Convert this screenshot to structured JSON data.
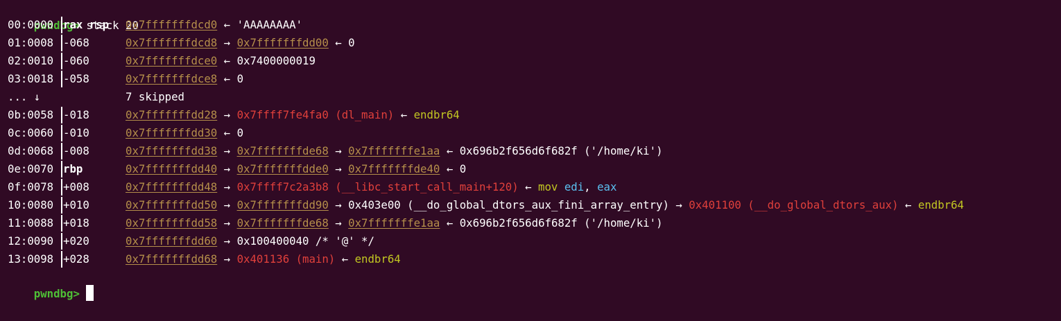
{
  "terminal": {
    "prompt": "pwndbg>",
    "command": "stack 20",
    "lines": [
      {
        "kind": "entry",
        "index": "00:0000",
        "off": "rax rsp",
        "off_bold": true,
        "chain": [
          {
            "t": "0x7fffffffdcd0",
            "c": "addr"
          },
          {
            "t": " ← ",
            "c": "white"
          },
          {
            "t": "'AAAAAAAA'",
            "c": "white"
          }
        ]
      },
      {
        "kind": "entry",
        "index": "01:0008",
        "off": "-068",
        "off_bold": false,
        "chain": [
          {
            "t": "0x7fffffffdcd8",
            "c": "addr"
          },
          {
            "t": " → ",
            "c": "white"
          },
          {
            "t": "0x7fffffffdd00",
            "c": "addr"
          },
          {
            "t": " ← ",
            "c": "white"
          },
          {
            "t": "0",
            "c": "white"
          }
        ]
      },
      {
        "kind": "entry",
        "index": "02:0010",
        "off": "-060",
        "off_bold": false,
        "chain": [
          {
            "t": "0x7fffffffdce0",
            "c": "addr"
          },
          {
            "t": " ← ",
            "c": "white"
          },
          {
            "t": "0x7400000019",
            "c": "white"
          }
        ]
      },
      {
        "kind": "entry",
        "index": "03:0018",
        "off": "-058",
        "off_bold": false,
        "chain": [
          {
            "t": "0x7fffffffdce8",
            "c": "addr"
          },
          {
            "t": " ← ",
            "c": "white"
          },
          {
            "t": "0",
            "c": "white"
          }
        ]
      },
      {
        "kind": "skip",
        "index": "... ↓",
        "text": "7 skipped"
      },
      {
        "kind": "entry",
        "index": "0b:0058",
        "off": "-018",
        "off_bold": false,
        "chain": [
          {
            "t": "0x7fffffffdd28",
            "c": "addr"
          },
          {
            "t": " → ",
            "c": "white"
          },
          {
            "t": "0x7ffff7fe4fa0 (dl_main)",
            "c": "code"
          },
          {
            "t": " ← ",
            "c": "white"
          },
          {
            "t": "endbr64",
            "c": "instr"
          }
        ]
      },
      {
        "kind": "entry",
        "index": "0c:0060",
        "off": "-010",
        "off_bold": false,
        "chain": [
          {
            "t": "0x7fffffffdd30",
            "c": "addr"
          },
          {
            "t": " ← ",
            "c": "white"
          },
          {
            "t": "0",
            "c": "white"
          }
        ]
      },
      {
        "kind": "entry",
        "index": "0d:0068",
        "off": "-008",
        "off_bold": false,
        "chain": [
          {
            "t": "0x7fffffffdd38",
            "c": "addr"
          },
          {
            "t": " → ",
            "c": "white"
          },
          {
            "t": "0x7fffffffde68",
            "c": "addr"
          },
          {
            "t": " → ",
            "c": "white"
          },
          {
            "t": "0x7fffffffe1aa",
            "c": "addr"
          },
          {
            "t": " ← ",
            "c": "white"
          },
          {
            "t": "0x696b2f656d6f682f ('/home/ki')",
            "c": "white"
          }
        ]
      },
      {
        "kind": "entry",
        "index": "0e:0070",
        "off": "rbp",
        "off_bold": true,
        "chain": [
          {
            "t": "0x7fffffffdd40",
            "c": "addr"
          },
          {
            "t": " → ",
            "c": "white"
          },
          {
            "t": "0x7fffffffdde0",
            "c": "addr"
          },
          {
            "t": " → ",
            "c": "white"
          },
          {
            "t": "0x7fffffffde40",
            "c": "addr"
          },
          {
            "t": " ← ",
            "c": "white"
          },
          {
            "t": "0",
            "c": "white"
          }
        ]
      },
      {
        "kind": "entry",
        "index": "0f:0078",
        "off": "+008",
        "off_bold": false,
        "chain": [
          {
            "t": "0x7fffffffdd48",
            "c": "addr"
          },
          {
            "t": " → ",
            "c": "white"
          },
          {
            "t": "0x7ffff7c2a3b8 (__libc_start_call_main+120)",
            "c": "code"
          },
          {
            "t": " ← ",
            "c": "white"
          },
          {
            "t": "mov ",
            "c": "instr"
          },
          {
            "t": "edi",
            "c": "reg"
          },
          {
            "t": ", ",
            "c": "white"
          },
          {
            "t": "eax",
            "c": "reg"
          }
        ]
      },
      {
        "kind": "entry",
        "index": "10:0080",
        "off": "+010",
        "off_bold": false,
        "chain": [
          {
            "t": "0x7fffffffdd50",
            "c": "addr"
          },
          {
            "t": " → ",
            "c": "white"
          },
          {
            "t": "0x7fffffffdd90",
            "c": "addr"
          },
          {
            "t": " → ",
            "c": "white"
          },
          {
            "t": "0x403e00 (__do_global_dtors_aux_fini_array_entry)",
            "c": "white"
          },
          {
            "t": " → ",
            "c": "white"
          },
          {
            "t": "0x401100 (__do_global_dtors_aux)",
            "c": "code"
          },
          {
            "t": " ← ",
            "c": "white"
          },
          {
            "t": "endbr64",
            "c": "instr"
          }
        ]
      },
      {
        "kind": "entry",
        "index": "11:0088",
        "off": "+018",
        "off_bold": false,
        "chain": [
          {
            "t": "0x7fffffffdd58",
            "c": "addr"
          },
          {
            "t": " → ",
            "c": "white"
          },
          {
            "t": "0x7fffffffde68",
            "c": "addr"
          },
          {
            "t": " → ",
            "c": "white"
          },
          {
            "t": "0x7fffffffe1aa",
            "c": "addr"
          },
          {
            "t": " ← ",
            "c": "white"
          },
          {
            "t": "0x696b2f656d6f682f ('/home/ki')",
            "c": "white"
          }
        ]
      },
      {
        "kind": "entry",
        "index": "12:0090",
        "off": "+020",
        "off_bold": false,
        "chain": [
          {
            "t": "0x7fffffffdd60",
            "c": "addr"
          },
          {
            "t": " → ",
            "c": "white"
          },
          {
            "t": "0x100400040 /* '@' */",
            "c": "white"
          }
        ]
      },
      {
        "kind": "entry",
        "index": "13:0098",
        "off": "+028",
        "off_bold": false,
        "chain": [
          {
            "t": "0x7fffffffdd68",
            "c": "addr"
          },
          {
            "t": " → ",
            "c": "white"
          },
          {
            "t": "0x401136 (main)",
            "c": "code"
          },
          {
            "t": " ← ",
            "c": "white"
          },
          {
            "t": "endbr64",
            "c": "instr"
          }
        ]
      }
    ],
    "final_prompt": "pwndbg>"
  }
}
